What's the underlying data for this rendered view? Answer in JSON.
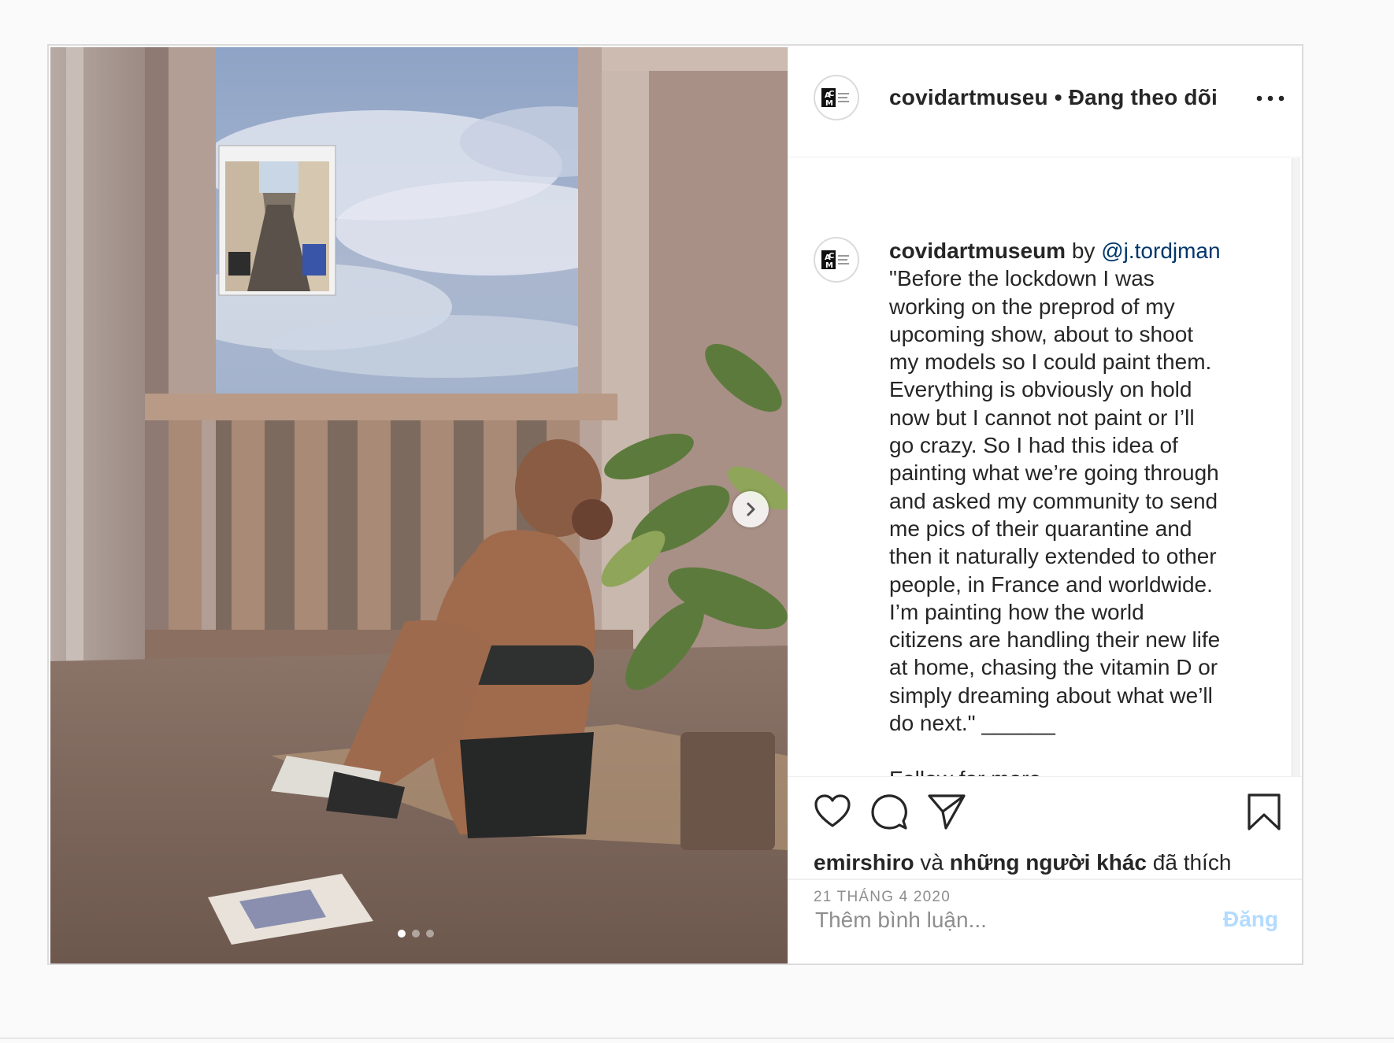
{
  "header": {
    "username": "covidartmuseu",
    "separator": " • ",
    "follow_status": "Đang theo dõi",
    "avatar_icon": "acm-logo-icon",
    "more_icon": "more-options-icon"
  },
  "caption": {
    "username": "covidartmuseum",
    "by": " by ",
    "mention": "@j.tordjman",
    "text": "\"Before the lockdown I was\nworking on the preprod of my\nupcoming show, about to shoot\nmy models so I could paint them.\nEverything is obviously on hold\nnow but I cannot not paint or I’ll\ngo crazy. So I had this idea of\npainting what we’re going through\nand asked my community to send\nme pics of their quarantine and\nthen it naturally extended to other\npeople, in France and worldwide.\nI’m painting how the world\ncitizens are handling their new life\nat home, chasing the vitamin D or\nsimply dreaming about what we’ll\ndo next.\" ______\n\nFollow for more"
  },
  "actions": {
    "like_icon": "heart-icon",
    "comment_icon": "comment-icon",
    "share_icon": "send-icon",
    "save_icon": "bookmark-icon"
  },
  "likes": {
    "user": "emirshiro",
    "and": " và ",
    "others": "những người khác",
    "liked": " đã thích"
  },
  "date": "21 THÁNG 4 2020",
  "comment_box": {
    "placeholder": "Thêm bình luận...",
    "post_label": "Đăng"
  },
  "carousel": {
    "slides": 3,
    "active": 1,
    "next_icon": "chevron-right-icon"
  },
  "colors": {
    "link": "#00376b",
    "post_disabled": "#b3dbff",
    "muted": "#8e8e8e"
  }
}
